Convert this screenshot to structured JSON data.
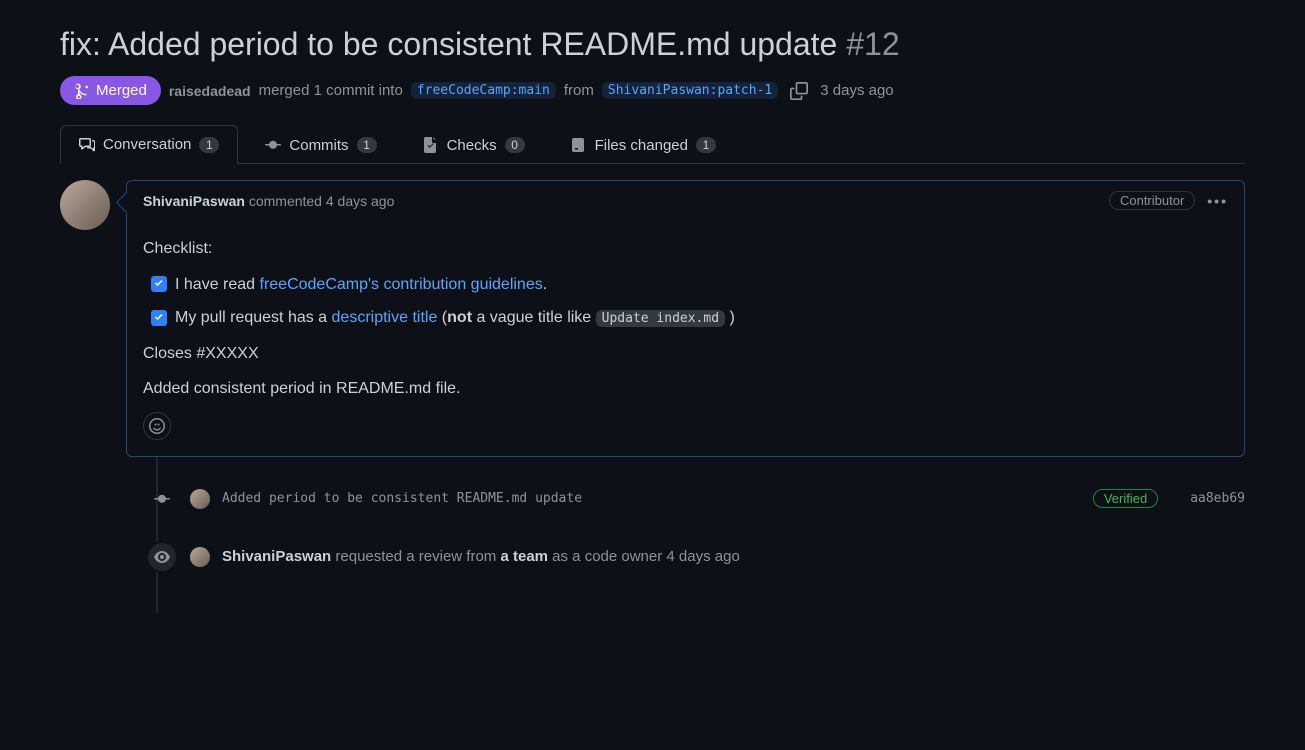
{
  "title": "fix: Added period to be consistent README.md update",
  "pr_number": "#12",
  "state": "Merged",
  "merged_by": "raisedadead",
  "merge_verb": "merged 1 commit into",
  "base_branch": "freeCodeCamp:main",
  "from_word": "from",
  "head_branch": "ShivaniPaswan:patch-1",
  "merged_time": "3 days ago",
  "tabs": {
    "conversation": {
      "label": "Conversation",
      "count": "1"
    },
    "commits": {
      "label": "Commits",
      "count": "1"
    },
    "checks": {
      "label": "Checks",
      "count": "0"
    },
    "files": {
      "label": "Files changed",
      "count": "1"
    }
  },
  "comment": {
    "author": "ShivaniPaswan",
    "action": "commented",
    "time": "4 days ago",
    "role_badge": "Contributor",
    "checklist_heading": "Checklist:",
    "item1_prefix": "I have read ",
    "item1_link": "freeCodeCamp's contribution guidelines",
    "item1_suffix": ".",
    "item2_prefix": "My pull request has a ",
    "item2_link": "descriptive title",
    "item2_mid1": " (",
    "item2_bold": "not",
    "item2_mid2": " a vague title like ",
    "item2_code": "Update index.md",
    "item2_suffix": " )",
    "closes": "Closes #XXXXX",
    "body": "Added consistent period in README.md file."
  },
  "commit_event": {
    "message": "Added period to be consistent README.md update",
    "verified": "Verified",
    "hash": "aa8eb69"
  },
  "review_event": {
    "author": "ShivaniPaswan",
    "text1": "requested a review from",
    "team": "a team",
    "text2": "as a code owner",
    "time": "4 days ago"
  }
}
